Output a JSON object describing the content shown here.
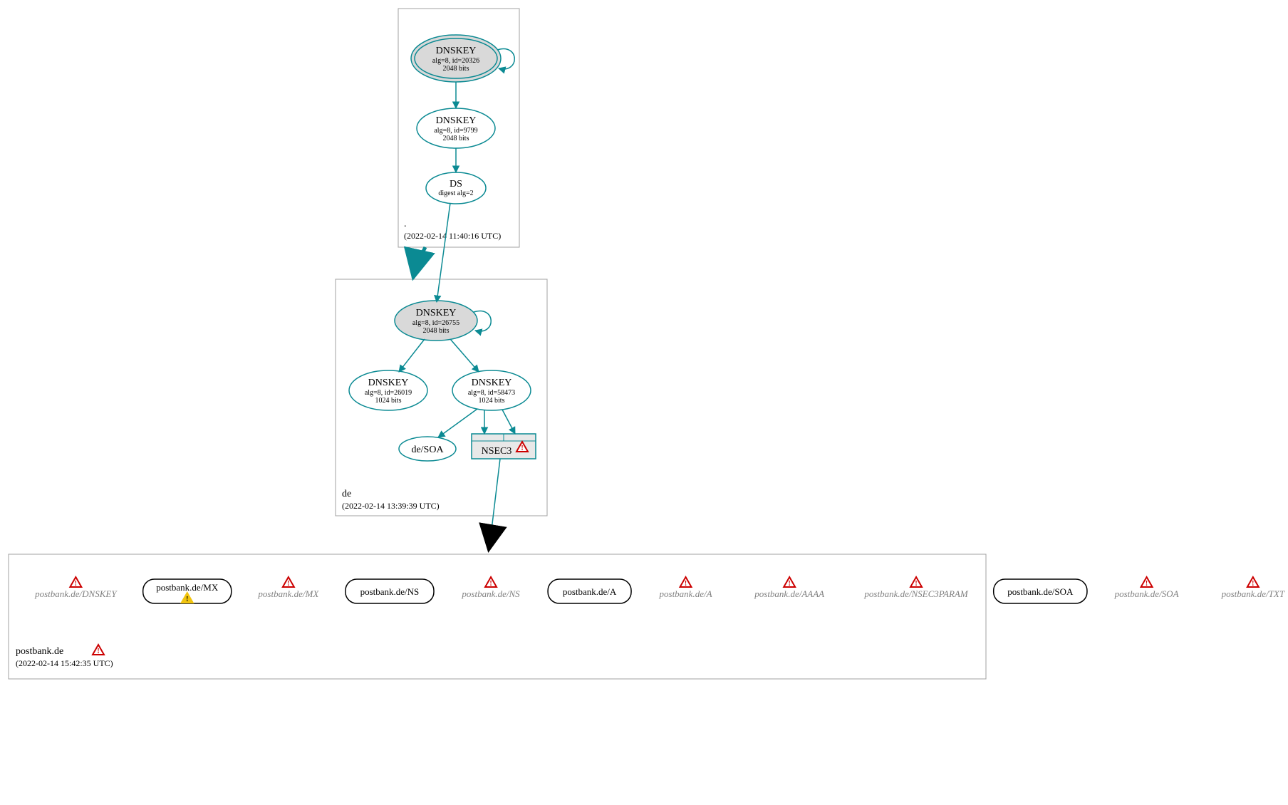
{
  "zones": {
    "root": {
      "name": ".",
      "timestamp": "(2022-02-14 11:40:16 UTC)",
      "nodes": {
        "ksk": {
          "title": "DNSKEY",
          "line2": "alg=8, id=20326",
          "line3": "2048 bits"
        },
        "zsk": {
          "title": "DNSKEY",
          "line2": "alg=8, id=9799",
          "line3": "2048 bits"
        },
        "ds": {
          "title": "DS",
          "line2": "digest alg=2"
        }
      }
    },
    "de": {
      "name": "de",
      "timestamp": "(2022-02-14 13:39:39 UTC)",
      "nodes": {
        "ksk": {
          "title": "DNSKEY",
          "line2": "alg=8, id=26755",
          "line3": "2048 bits"
        },
        "zsk1": {
          "title": "DNSKEY",
          "line2": "alg=8, id=26019",
          "line3": "1024 bits"
        },
        "zsk2": {
          "title": "DNSKEY",
          "line2": "alg=8, id=58473",
          "line3": "1024 bits"
        },
        "soa": {
          "label": "de/SOA"
        },
        "nsec3": {
          "label": "NSEC3"
        }
      }
    },
    "postbank": {
      "name": "postbank.de",
      "timestamp": "(2022-02-14 15:42:35 UTC)",
      "rrsets": [
        {
          "label": "postbank.de/DNSKEY",
          "box": false,
          "warn": "red"
        },
        {
          "label": "postbank.de/MX",
          "box": true,
          "warn": "yellow"
        },
        {
          "label": "postbank.de/MX",
          "box": false,
          "warn": "red"
        },
        {
          "label": "postbank.de/NS",
          "box": true,
          "warn": null
        },
        {
          "label": "postbank.de/NS",
          "box": false,
          "warn": "red"
        },
        {
          "label": "postbank.de/A",
          "box": true,
          "warn": null
        },
        {
          "label": "postbank.de/A",
          "box": false,
          "warn": "red"
        },
        {
          "label": "postbank.de/AAAA",
          "box": false,
          "warn": "red"
        },
        {
          "label": "postbank.de/NSEC3PARAM",
          "box": false,
          "warn": "red"
        },
        {
          "label": "postbank.de/SOA",
          "box": true,
          "warn": null
        },
        {
          "label": "postbank.de/SOA",
          "box": false,
          "warn": "red"
        },
        {
          "label": "postbank.de/TXT",
          "box": false,
          "warn": "red"
        }
      ],
      "zone_warn": true
    }
  },
  "colors": {
    "teal": "#0b8a93",
    "gray_fill": "#d9d9d9",
    "light_gray_fill": "#e8e8e8",
    "box_border": "#a0a0a0",
    "red": "#cc0000",
    "yellow": "#f1c40f",
    "text_gray": "#808080"
  }
}
